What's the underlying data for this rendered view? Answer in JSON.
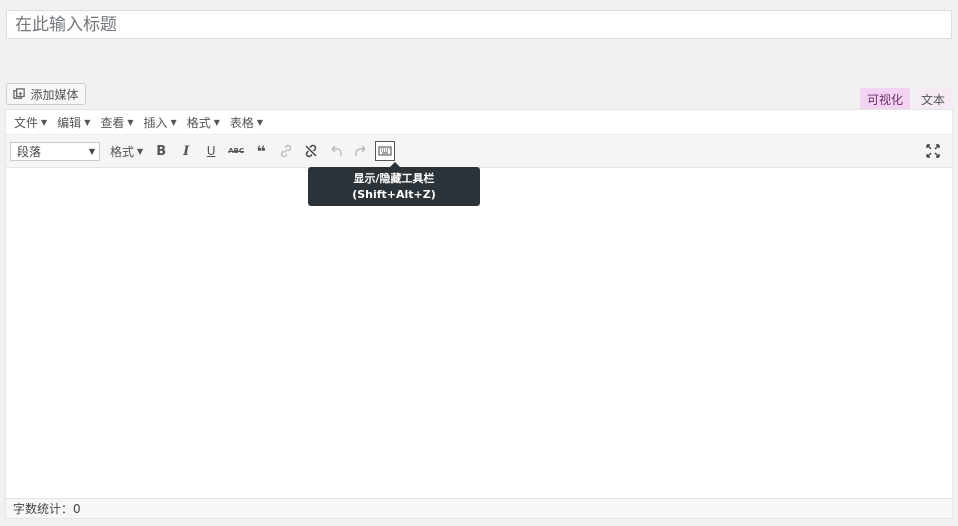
{
  "title": {
    "placeholder": "在此输入标题"
  },
  "media_button": {
    "label": "添加媒体"
  },
  "mode_tabs": {
    "visual": "可视化",
    "text": "文本"
  },
  "menubar": {
    "items": [
      {
        "label": "文件"
      },
      {
        "label": "编辑"
      },
      {
        "label": "查看"
      },
      {
        "label": "插入"
      },
      {
        "label": "格式"
      },
      {
        "label": "表格"
      }
    ]
  },
  "toolbar": {
    "format_select": "段落",
    "formats_menu": "格式",
    "bold": "B",
    "italic": "I",
    "underline": "U",
    "strikethrough": "ABC",
    "blockquote": "❝"
  },
  "tooltip": {
    "line1": "显示/隐藏工具栏",
    "line2": "(Shift+Alt+Z)"
  },
  "statusbar": {
    "word_count": "字数统计：0"
  }
}
